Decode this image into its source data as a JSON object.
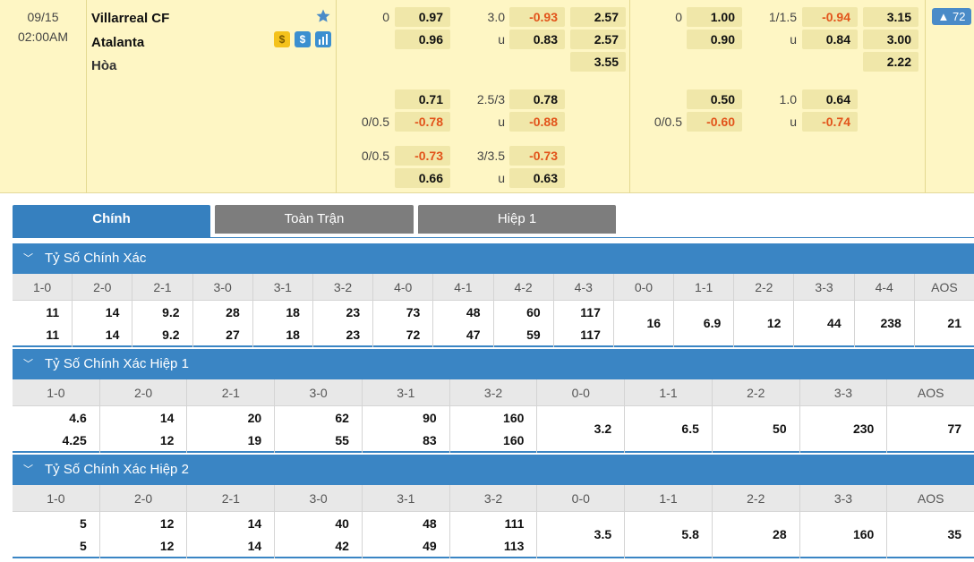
{
  "match": {
    "date": "09/15",
    "time": "02:00AM",
    "home": "Villarreal CF",
    "away": "Atalanta",
    "draw": "Hòa",
    "more_count": "72"
  },
  "odds": {
    "ft": {
      "hdp_lines": [
        "0",
        "",
        "",
        "0/0.5",
        "0/0.5",
        ""
      ],
      "hdp_vals": [
        "0.97",
        "0.96",
        "0.71",
        "-0.78",
        "-0.73",
        "0.66"
      ],
      "ou_lines": [
        "3.0",
        "u",
        "2.5/3",
        "u",
        "3/3.5",
        "u"
      ],
      "ou_vals": [
        "-0.93",
        "0.83",
        "0.78",
        "-0.88",
        "-0.73",
        "0.63"
      ],
      "x12": [
        "2.57",
        "2.57",
        "3.55"
      ]
    },
    "ht": {
      "hdp_lines": [
        "0",
        "",
        "",
        "0/0.5"
      ],
      "hdp_vals": [
        "1.00",
        "0.90",
        "0.50",
        "-0.60"
      ],
      "ou_lines": [
        "1/1.5",
        "u",
        "1.0",
        "u"
      ],
      "ou_vals": [
        "-0.94",
        "0.84",
        "0.64",
        "-0.74"
      ],
      "x12": [
        "3.15",
        "3.00",
        "2.22"
      ]
    }
  },
  "tabs": [
    "Chính",
    "Toàn Trận",
    "Hiệp 1"
  ],
  "sections": [
    {
      "title": "Tỷ Số Chính Xác",
      "headers": [
        "1-0",
        "2-0",
        "2-1",
        "3-0",
        "3-1",
        "3-2",
        "4-0",
        "4-1",
        "4-2",
        "4-3",
        "0-0",
        "1-1",
        "2-2",
        "3-3",
        "4-4",
        "AOS"
      ],
      "home": [
        "11",
        "14",
        "9.2",
        "28",
        "18",
        "23",
        "73",
        "48",
        "60",
        "117"
      ],
      "away": [
        "11",
        "14",
        "9.2",
        "27",
        "18",
        "23",
        "72",
        "47",
        "59",
        "117"
      ],
      "single": [
        "16",
        "6.9",
        "12",
        "44",
        "238",
        "21"
      ]
    },
    {
      "title": "Tỷ Số Chính Xác Hiệp 1",
      "headers": [
        "1-0",
        "2-0",
        "2-1",
        "3-0",
        "3-1",
        "3-2",
        "0-0",
        "1-1",
        "2-2",
        "3-3",
        "AOS"
      ],
      "home": [
        "4.6",
        "14",
        "20",
        "62",
        "90",
        "160"
      ],
      "away": [
        "4.25",
        "12",
        "19",
        "55",
        "83",
        "160"
      ],
      "single": [
        "3.2",
        "6.5",
        "50",
        "230",
        "77"
      ]
    },
    {
      "title": "Tỷ Số Chính Xác Hiệp 2",
      "headers": [
        "1-0",
        "2-0",
        "2-1",
        "3-0",
        "3-1",
        "3-2",
        "0-0",
        "1-1",
        "2-2",
        "3-3",
        "AOS"
      ],
      "home": [
        "5",
        "12",
        "14",
        "40",
        "48",
        "111"
      ],
      "away": [
        "5",
        "12",
        "14",
        "42",
        "49",
        "113"
      ],
      "single": [
        "3.5",
        "5.8",
        "28",
        "160",
        "35"
      ]
    }
  ],
  "colors": {
    "match_bg": "#fef6c4",
    "odds_box": "#f0e7a9",
    "negative": "#e2541b",
    "accent": "#3a85c4",
    "tab_inactive": "#7d7d7d"
  },
  "icons": [
    "star-icon",
    "coin-icon",
    "dollar-icon",
    "bar-chart-icon",
    "chevron-up-icon",
    "chevron-down-icon"
  ]
}
